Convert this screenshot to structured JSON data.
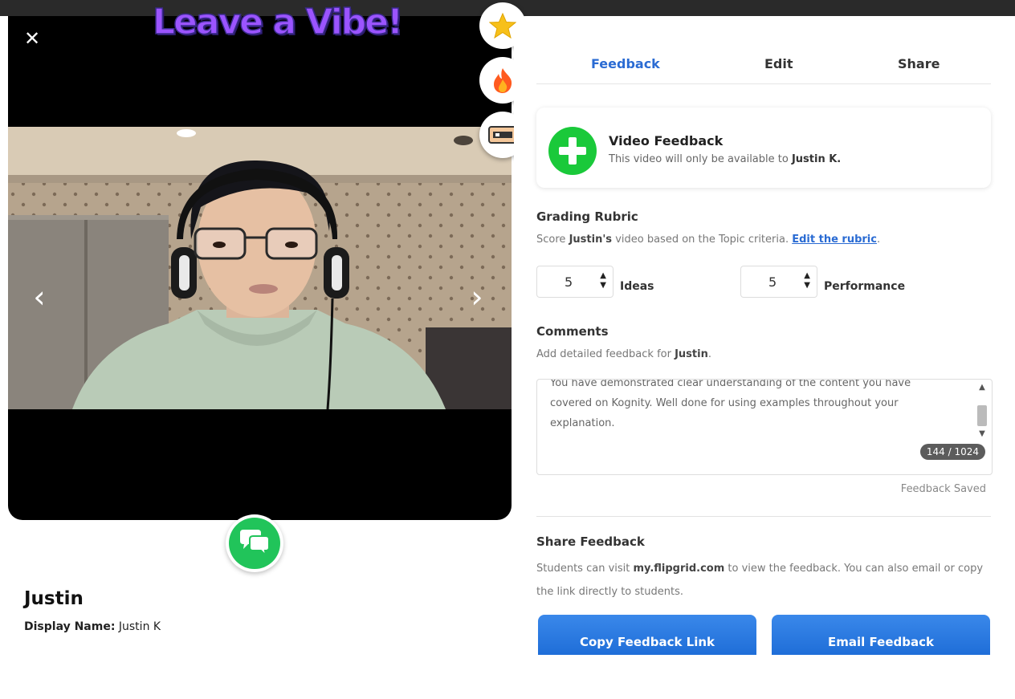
{
  "vibe": {
    "title": "Leave a Vibe!"
  },
  "video": {
    "close_glyph": "✕",
    "prev_glyph": "‹",
    "next_glyph": "›"
  },
  "stickers": [
    {
      "name": "star-icon"
    },
    {
      "name": "fire-icon"
    },
    {
      "name": "sticker-card-icon"
    }
  ],
  "student": {
    "name": "Justin",
    "display_name_label": "Display Name:",
    "display_name": "Justin K"
  },
  "tabs": [
    {
      "label": "Feedback",
      "active": true
    },
    {
      "label": "Edit",
      "active": false
    },
    {
      "label": "Share",
      "active": false
    }
  ],
  "video_feedback": {
    "title": "Video Feedback",
    "subtitle_prefix": "This video will only be available to",
    "student": "Justin K."
  },
  "rubric": {
    "title": "Grading Rubric",
    "subtitle_prefix": "Score",
    "subtitle_student": "Justin's",
    "subtitle_mid": "video based on the Topic criteria.",
    "edit_link": "Edit the rubric",
    "subtitle_end": ".",
    "criteria": [
      {
        "label": "Ideas",
        "score": "5"
      },
      {
        "label": "Performance",
        "score": "5"
      }
    ],
    "stepper_glyph": "▲▼"
  },
  "comments": {
    "title": "Comments",
    "subtitle_prefix": "Add detailed feedback for",
    "subtitle_student": "Justin",
    "subtitle_end": ".",
    "text": "You have demonstrated clear understanding of the content you have covered on Kognity.  Well done for using examples throughout your explanation.",
    "char_count": "144 / 1024",
    "status": "Feedback Saved"
  },
  "share": {
    "title": "Share Feedback",
    "text_prefix": "Students can visit",
    "site": "my.flipgrid.com",
    "text_suffix": "to view the feedback. You can also email or copy the link directly to students.",
    "copy_button": "Copy Feedback Link",
    "email_button": "Email Feedback"
  },
  "colors": {
    "accent_blue": "#2a6bd3",
    "green": "#1ac93a",
    "vibe_purple": "#9b54ff"
  }
}
